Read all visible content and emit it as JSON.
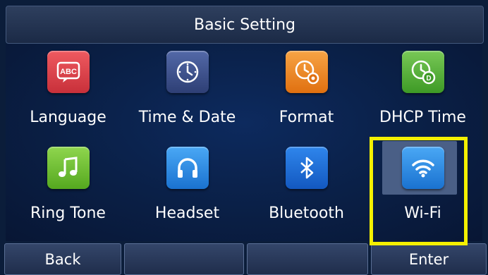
{
  "header": {
    "title": "Basic Setting"
  },
  "menu": {
    "items": [
      {
        "label": "Language",
        "icon": "language-abc-icon",
        "color": "#e0444c"
      },
      {
        "label": "Time & Date",
        "icon": "clock-icon",
        "color": "#3b4f8c"
      },
      {
        "label": "Format",
        "icon": "clock-gear-icon",
        "color": "#f08a1c"
      },
      {
        "label": "DHCP Time",
        "icon": "clock-dhcp-icon",
        "color": "#5ab33a"
      },
      {
        "label": "Ring Tone",
        "icon": "music-note-icon",
        "color": "#6cbf2e"
      },
      {
        "label": "Headset",
        "icon": "headset-icon",
        "color": "#2d8fe6"
      },
      {
        "label": "Bluetooth",
        "icon": "bluetooth-icon",
        "color": "#1b6fd8"
      },
      {
        "label": "Wi-Fi",
        "icon": "wifi-icon",
        "color": "#2d8fe6",
        "selected": true
      }
    ]
  },
  "softkeys": {
    "back": "Back",
    "empty1": "",
    "empty2": "",
    "enter": "Enter"
  },
  "colors": {
    "screen_bg": "#0b1d3a",
    "highlight_outline": "#f4f000",
    "selection_bg": "#4a5f86"
  }
}
